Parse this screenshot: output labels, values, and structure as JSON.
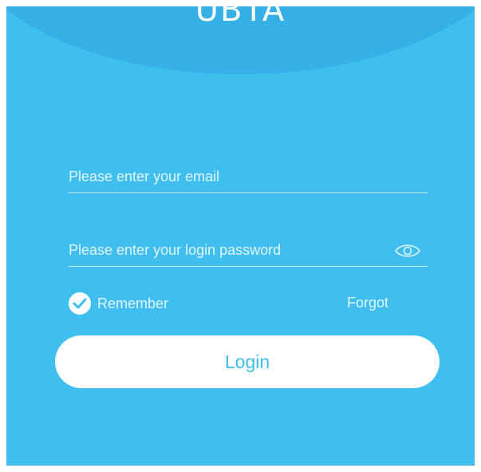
{
  "app": {
    "brand": "UBTA"
  },
  "form": {
    "email_placeholder": "Please enter your email",
    "email_value": "",
    "password_placeholder": "Please enter your login password",
    "password_value": "",
    "remember_label": "Remember",
    "remember_checked": true,
    "forgot_label": "Forgot",
    "login_label": "Login"
  },
  "icons": {
    "password_toggle": "eye-icon",
    "remember_check": "check-circle-icon"
  },
  "colors": {
    "background": "#3fbef0",
    "header_arc": "#36b0e6",
    "button": "#ffffff",
    "button_text": "#3fbef0"
  }
}
